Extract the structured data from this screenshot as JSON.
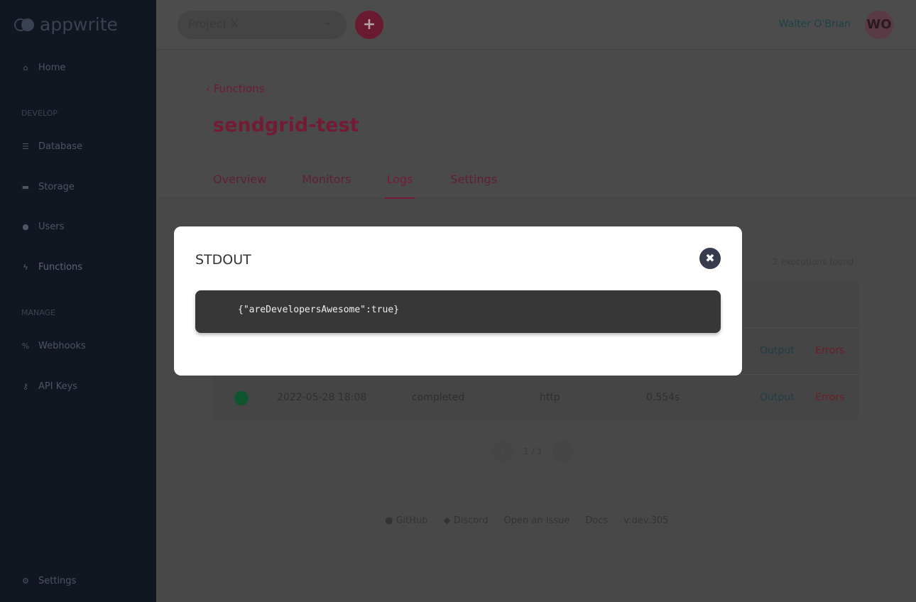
{
  "brand": "appwrite",
  "sidebar": {
    "home": "Home",
    "develop_label": "DEVELOP",
    "items": [
      {
        "label": "Database",
        "icon": "database-icon"
      },
      {
        "label": "Storage",
        "icon": "folder-icon"
      },
      {
        "label": "Users",
        "icon": "users-icon"
      },
      {
        "label": "Functions",
        "icon": "bolt-icon"
      }
    ],
    "manage_label": "MANAGE",
    "manage_items": [
      {
        "label": "Webhooks",
        "icon": "link-icon"
      },
      {
        "label": "API Keys",
        "icon": "key-icon"
      }
    ],
    "settings": "Settings"
  },
  "header": {
    "project": "Project X",
    "user": "Walter O'Brian",
    "avatar": "WO"
  },
  "page": {
    "back": "Functions",
    "title": "sendgrid-test",
    "tabs": [
      "Overview",
      "Monitors",
      "Logs",
      "Settings"
    ],
    "active_tab": "Logs"
  },
  "logs": {
    "count": "2 executions found",
    "rows": [
      {
        "output": "Output",
        "errors": "Errors"
      },
      {
        "status": "completed",
        "date": "2022-05-28 18:08",
        "trigger": "http",
        "time": "0.554s",
        "output": "Output",
        "errors": "Errors",
        "status_color": "#0e5530"
      }
    ],
    "pager": "1 / 1"
  },
  "footer": {
    "github": "GitHub",
    "discord": "Discord",
    "issue": "Open an Issue",
    "docs": "Docs",
    "version": "v:dev.305"
  },
  "modal": {
    "title": "STDOUT",
    "content": "{\"areDevelopersAwesome\":true}"
  }
}
